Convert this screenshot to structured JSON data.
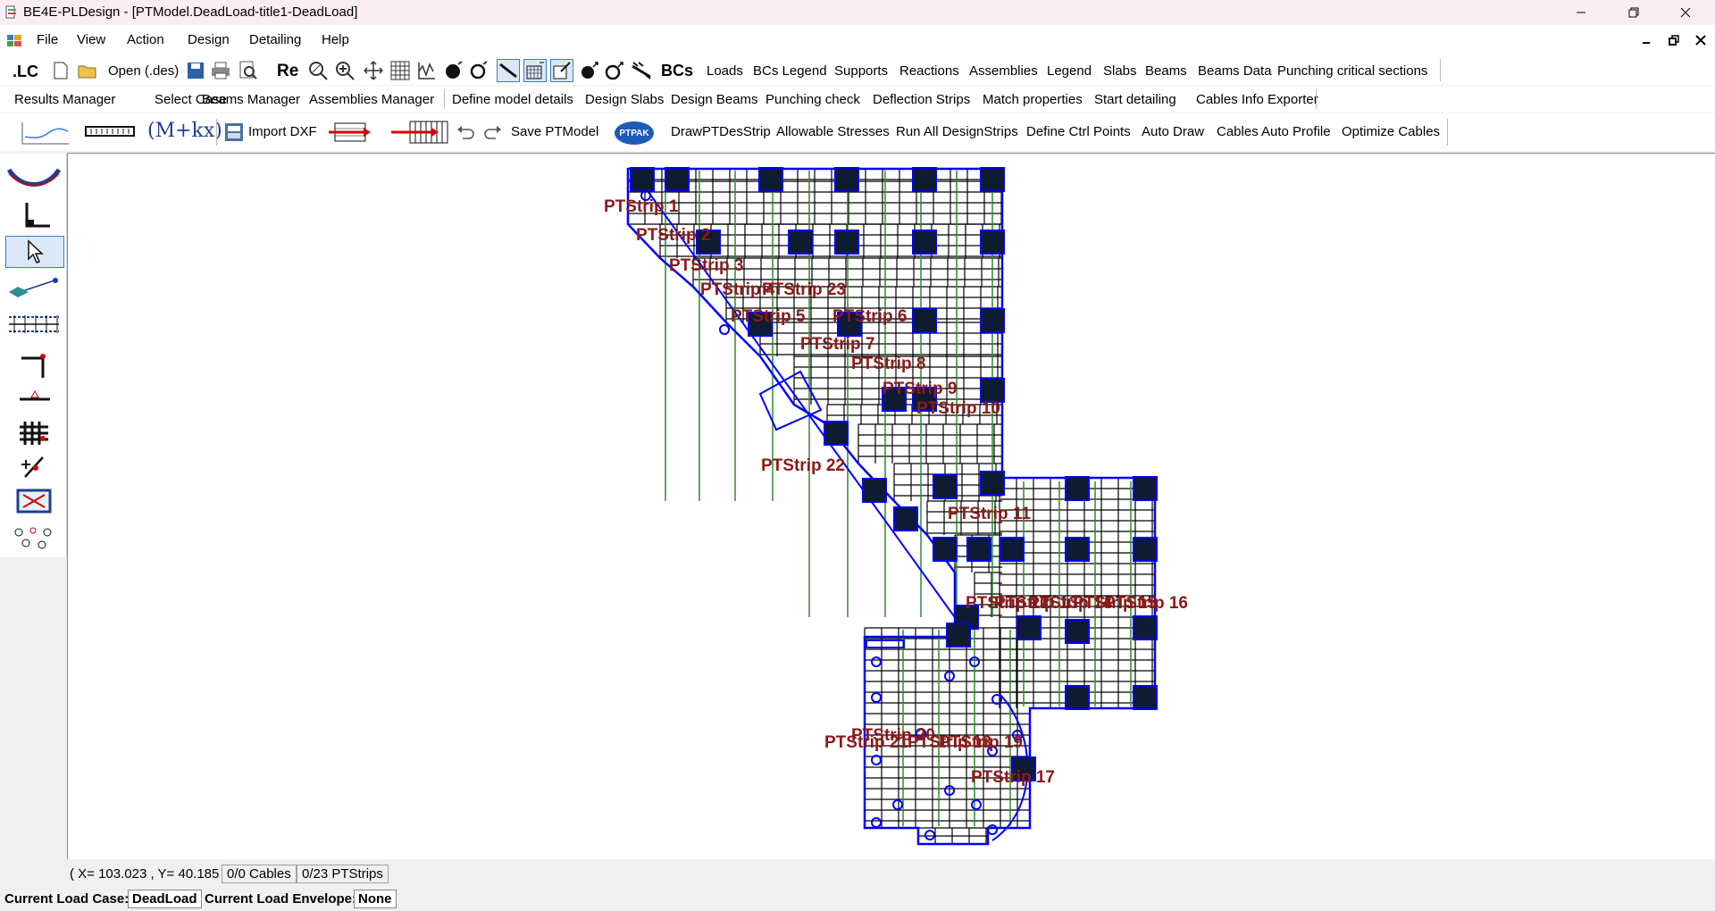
{
  "window": {
    "title": "BE4E-PLDesign - [PTModel.DeadLoad-title1-DeadLoad]"
  },
  "menu": {
    "items": [
      "File",
      "View",
      "Action",
      "Design",
      "Detailing",
      "Help"
    ]
  },
  "toolbar1": {
    "lc": ".LC",
    "open": "Open (.des)",
    "re": "Re",
    "bcs": "BCs",
    "labels": [
      "Loads",
      "BCs Legend",
      "Supports",
      "Reactions",
      "Assemblies",
      "Legend",
      "Slabs",
      "Beams",
      "Beams Data",
      "Punching critical sections"
    ]
  },
  "toolbar2": {
    "labels": [
      "Results Manager",
      "Select Case",
      "Beams Manager",
      "Assemblies Manager",
      "Define model details",
      "Design Slabs",
      "Design Beams",
      "Punching check",
      "Deflection Strips",
      "Match properties",
      "Start detailing",
      "Cables Info Exporter"
    ]
  },
  "toolbar3": {
    "formula": "(M+kx)",
    "import_dxf": "Import DXF",
    "save": "Save PTModel",
    "ptpak": "PTPAK",
    "labels": [
      "DrawPTDesStrip",
      "Allowable Stresses",
      "Run All DesignStrips",
      "Define Ctrl Points",
      "Auto Draw",
      "Cables Auto Profile",
      "Optimize Cables"
    ]
  },
  "canvas": {
    "strip_labels": [
      "PTStrip 1",
      "PTStrip 2",
      "PTStrip 3",
      "PTStrip 4",
      "PTStrip 23",
      "PTStrip 5",
      "PTStrip 6",
      "PTStrip 7",
      "PTStrip 8",
      "PTStrip 9",
      "PTStrip 10",
      "PTStrip 22",
      "PTStrip 11",
      "PTStrip 12",
      "PTStrip 13",
      "PTStrip 14",
      "PTStrip 15",
      "PTStrip 16",
      "PTStrip 20",
      "PTStrip 21",
      "PTStrip 18",
      "PTStrip 19",
      "PTStrip 17"
    ]
  },
  "status": {
    "coords": "( X= 103.023 , Y= 40.185 )",
    "cables": "0/0 Cables",
    "ptstrips": "0/23 PTStrips",
    "load_case_label": "Current Load Case:",
    "load_case_value": "DeadLoad",
    "envelope_label": "Current Load Envelope:",
    "envelope_value": "None"
  },
  "colors": {
    "accent": "#0000ff",
    "labels": "#8b1a1a",
    "grid": "#000000",
    "strip_lines": "#2e8b2e"
  }
}
